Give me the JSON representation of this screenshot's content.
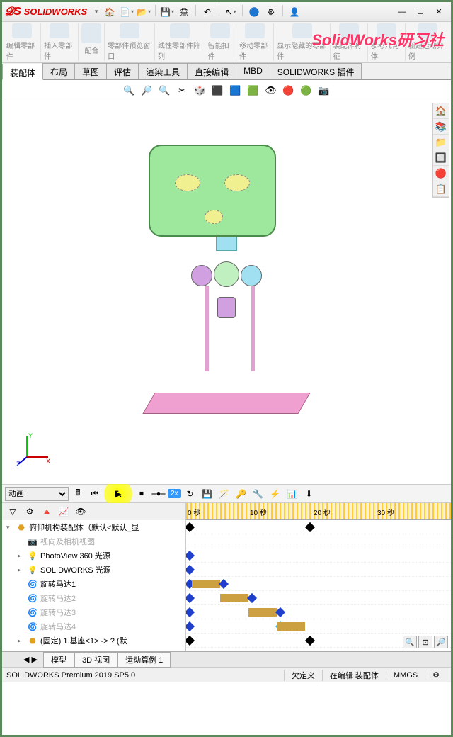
{
  "app": {
    "name": "SOLIDWORKS"
  },
  "watermark": "SolidWorks研习社",
  "ribbon": {
    "groups": [
      "编辑零部件",
      "插入零部件",
      "配合",
      "零部件预览窗口",
      "线性零部件阵列",
      "智能扣件",
      "移动零部件",
      "显示隐藏的零部件",
      "装配体特征",
      "参考几何体",
      "新建运动算例"
    ]
  },
  "tabs": [
    "装配体",
    "布局",
    "草图",
    "评估",
    "渲染工具",
    "直接编辑",
    "MBD",
    "SOLIDWORKS 插件"
  ],
  "motion": {
    "study_type": "动画",
    "speed": "2x",
    "timeline_marks": [
      "0 秒",
      "10 秒",
      "20 秒",
      "30 秒"
    ]
  },
  "tree": {
    "root": "俯仰机构装配体（默认<默认_显",
    "items": [
      {
        "icon": "cam",
        "label": "视向及相机视图",
        "off": true
      },
      {
        "icon": "light",
        "label": "PhotoView 360 光源",
        "exp": "▸"
      },
      {
        "icon": "light",
        "label": "SOLIDWORKS 光源",
        "exp": "▸"
      },
      {
        "icon": "motor",
        "label": "旋转马达1"
      },
      {
        "icon": "motor",
        "label": "旋转马达2",
        "off": true
      },
      {
        "icon": "motor",
        "label": "旋转马达3",
        "off": true
      },
      {
        "icon": "motor",
        "label": "旋转马达4",
        "off": true
      },
      {
        "icon": "part",
        "label": "(固定) 1.基座<1> -> ? (默",
        "exp": "▸"
      }
    ]
  },
  "bottom_tabs": [
    "模型",
    "3D 视图",
    "运动算例 1"
  ],
  "status": {
    "version": "SOLIDWORKS Premium 2019 SP5.0",
    "def": "欠定义",
    "mode": "在编辑 装配体",
    "units": "MMGS"
  }
}
